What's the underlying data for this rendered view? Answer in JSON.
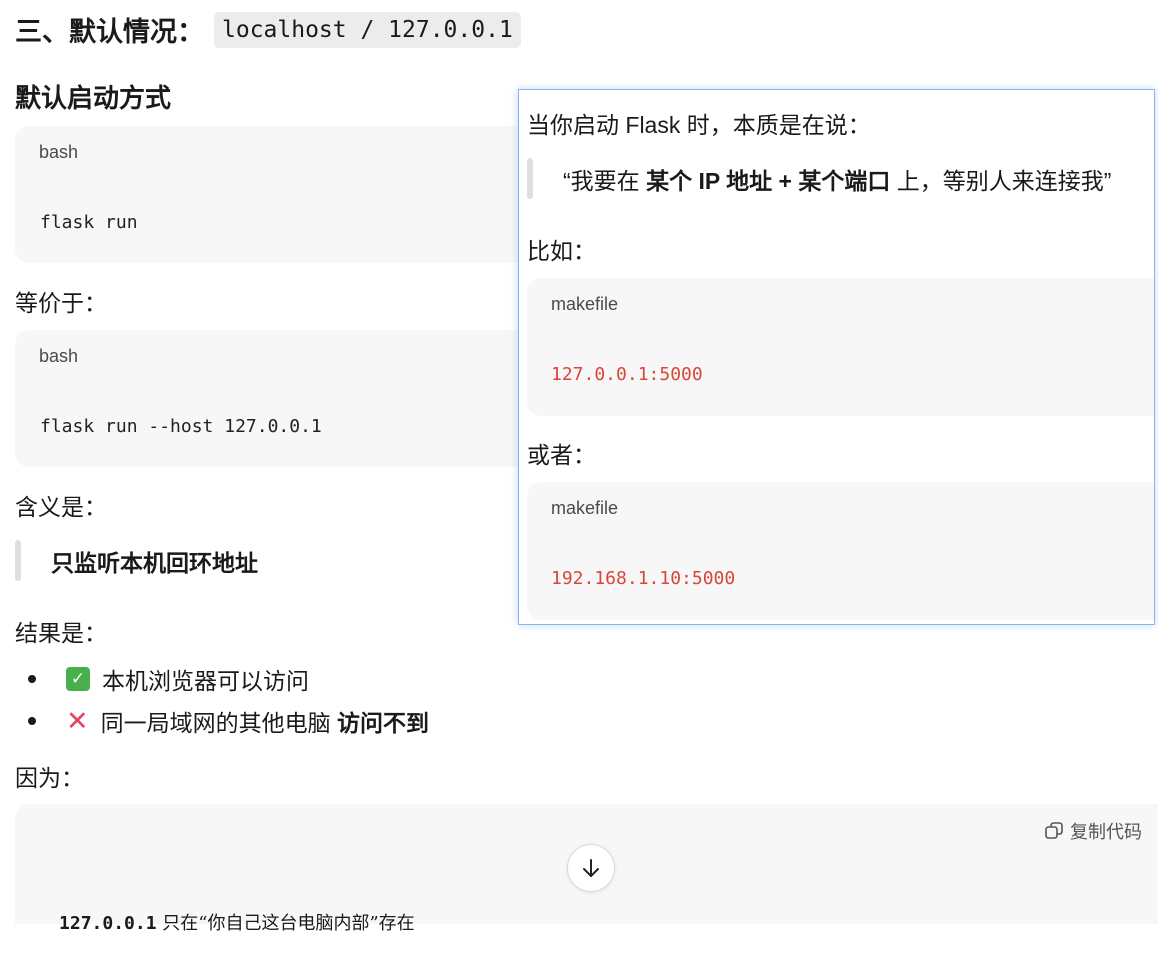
{
  "heading": {
    "text": "三、默认情况：",
    "code": "localhost / 127.0.0.1"
  },
  "subheading": "默认启动方式",
  "block1": {
    "lang": "bash",
    "code": "flask run"
  },
  "equiv_label": "等价于：",
  "block2": {
    "lang": "bash",
    "code": "flask run --host 127.0.0.1"
  },
  "meaning_label": "含义是：",
  "meaning_quote": "只监听本机回环地址",
  "result_label": "结果是：",
  "results": [
    {
      "icon": "check-icon",
      "text": "本机浏览器可以访问",
      "bold": ""
    },
    {
      "icon": "cross-icon",
      "text": "同一局域网的其他电脑 ",
      "bold": "访问不到"
    }
  ],
  "because_label": "因为：",
  "bottom_block": {
    "copy_label": "复制代码",
    "code": "127.0.0.1",
    "text": " 只在“你自己这台电脑内部”存在"
  },
  "popup": {
    "intro": "当你启动 Flask 时，本质是在说：",
    "quote": {
      "p1": "“我要在 ",
      "b1": "某个 IP 地址",
      "p2": " + ",
      "b2": "某个端口",
      "p3": " 上，等别人来连接我”"
    },
    "example_label": "比如：",
    "ex1": {
      "lang": "makefile",
      "code": "127.0.0.1:5000"
    },
    "or_label": "或者：",
    "ex2": {
      "lang": "makefile",
      "code": "192.168.1.10:5000"
    }
  }
}
